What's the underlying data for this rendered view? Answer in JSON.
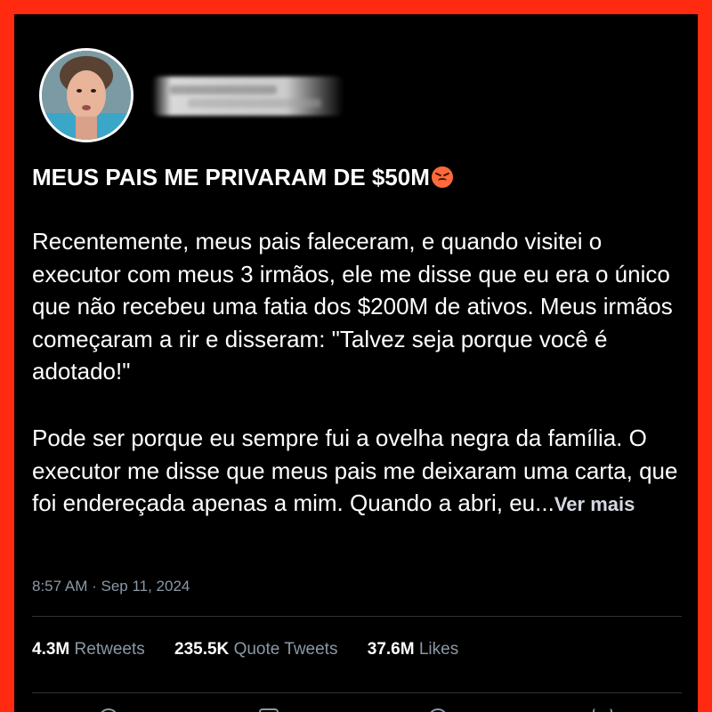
{
  "tweet": {
    "headline": "MEUS PAIS ME PRIVARAM DE $50M",
    "headline_emoji": "angry-face",
    "paragraph1": "Recentemente, meus pais faleceram, e quando visitei o executor com meus 3 irmãos, ele me disse que eu era o único que não recebeu uma fatia dos $200M de ativos. Meus irmãos começaram a rir e disseram: \"Talvez seja porque você é adotado!\"",
    "paragraph2": "Pode ser porque eu sempre fui a ovelha negra da família. O executor me disse que meus pais me deixaram uma carta, que foi endereçada apenas a mim. Quando a abri, eu...",
    "see_more": "Ver mais",
    "timestamp": "8:57 AM · Sep 11, 2024"
  },
  "stats": {
    "retweets_count": "4.3M",
    "retweets_label": "Retweets",
    "quotes_count": "235.5K",
    "quotes_label": "Quote Tweets",
    "likes_count": "37.6M",
    "likes_label": "Likes"
  },
  "colors": {
    "frame": "#ff2a10",
    "background": "#000000",
    "muted": "#8b98a5"
  },
  "icons": [
    "reply-icon",
    "retweet-icon",
    "like-icon",
    "share-icon"
  ]
}
